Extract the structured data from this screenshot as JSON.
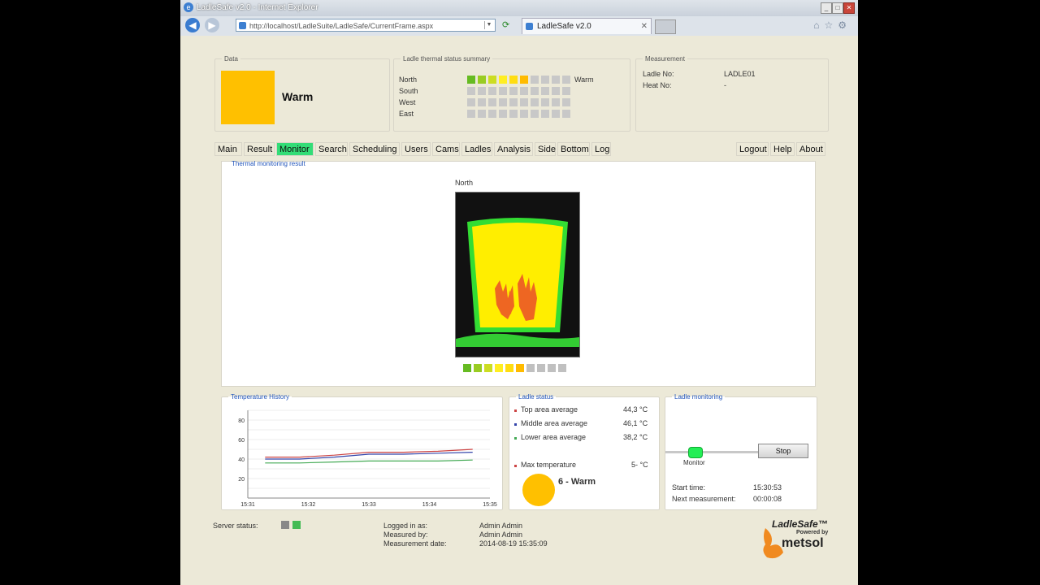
{
  "window": {
    "title": "LadleSafe v2.0 - Internet Explorer",
    "address": "http://localhost/LadleSuite/LadleSafe/CurrentFrame.aspx",
    "tab_label": "LadleSafe v2.0"
  },
  "data_box": {
    "legend": "Data",
    "status": "Warm",
    "color": "#ffc000"
  },
  "summary": {
    "legend": "Ladle thermal status summary",
    "rows": [
      {
        "name": "North",
        "label": "Warm",
        "cells": [
          "#66bb22",
          "#99cc22",
          "#ccdd22",
          "#ffee22",
          "#ffdd11",
          "#ffbb00",
          "#c8c8c8",
          "#c8c8c8",
          "#c8c8c8",
          "#c8c8c8"
        ]
      },
      {
        "name": "South",
        "label": "",
        "cells": [
          "#c8c8c8",
          "#c8c8c8",
          "#c8c8c8",
          "#c8c8c8",
          "#c8c8c8",
          "#c8c8c8",
          "#c8c8c8",
          "#c8c8c8",
          "#c8c8c8",
          "#c8c8c8"
        ]
      },
      {
        "name": "West",
        "label": "",
        "cells": [
          "#c8c8c8",
          "#c8c8c8",
          "#c8c8c8",
          "#c8c8c8",
          "#c8c8c8",
          "#c8c8c8",
          "#c8c8c8",
          "#c8c8c8",
          "#c8c8c8",
          "#c8c8c8"
        ]
      },
      {
        "name": "East",
        "label": "",
        "cells": [
          "#c8c8c8",
          "#c8c8c8",
          "#c8c8c8",
          "#c8c8c8",
          "#c8c8c8",
          "#c8c8c8",
          "#c8c8c8",
          "#c8c8c8",
          "#c8c8c8",
          "#c8c8c8"
        ]
      }
    ]
  },
  "measurement": {
    "legend": "Measurement",
    "ladle_label": "Ladle No:",
    "ladle_value": "LADLE01",
    "heat_label": "Heat No:",
    "heat_value": "-"
  },
  "menu_left": [
    "Main",
    "Result",
    "Monitor",
    "Search",
    "Scheduling",
    "Users",
    "Cams",
    "Ladles",
    "Analysis",
    "Side",
    "Bottom",
    "Log"
  ],
  "menu_active": "Monitor",
  "menu_right": [
    "Logout",
    "Help",
    "About"
  ],
  "monitor": {
    "legend": "Thermal monitoring result",
    "view": "North",
    "scale": [
      "#66bb22",
      "#99cc22",
      "#ccdd22",
      "#ffee22",
      "#ffdd11",
      "#ffbb00",
      "#c0c0c0",
      "#c0c0c0",
      "#c0c0c0",
      "#c0c0c0"
    ]
  },
  "chart_data": {
    "type": "line",
    "title": "Temperature History",
    "x": [
      "15:31",
      "15:32",
      "15:33",
      "15:34",
      "15:35"
    ],
    "ylim": [
      0,
      90
    ],
    "yticks": [
      20,
      40,
      60,
      80
    ],
    "series": [
      {
        "color": "#cc4444",
        "points": [
          [
            15.5,
            42
          ],
          [
            16.5,
            42
          ],
          [
            17.5,
            44
          ],
          [
            18.5,
            47
          ],
          [
            19.5,
            47
          ],
          [
            20.5,
            48
          ],
          [
            21.5,
            50
          ]
        ]
      },
      {
        "color": "#3344aa",
        "points": [
          [
            15.5,
            40
          ],
          [
            16.5,
            40
          ],
          [
            17.5,
            42
          ],
          [
            18.5,
            45
          ],
          [
            19.5,
            45
          ],
          [
            20.5,
            46
          ],
          [
            21.5,
            47
          ]
        ]
      },
      {
        "color": "#44aa55",
        "points": [
          [
            15.5,
            36
          ],
          [
            16.5,
            36
          ],
          [
            17.5,
            37
          ],
          [
            18.5,
            38
          ],
          [
            19.5,
            38
          ],
          [
            20.5,
            38
          ],
          [
            21.5,
            39
          ]
        ]
      }
    ]
  },
  "ladle_status": {
    "legend": "Ladle status",
    "rows": [
      {
        "label": "Top area average",
        "value": "44,3 °C",
        "color": "#cc4444"
      },
      {
        "label": "Middle area average",
        "value": "46,1 °C",
        "color": "#3344aa"
      },
      {
        "label": "Lower area average",
        "value": "38,2 °C",
        "color": "#44aa55"
      }
    ],
    "max_label": "Max temperature",
    "max_value": "5- °C",
    "max_color": "#cc4444",
    "level_text": "6 - Warm",
    "level_color": "#ffc000"
  },
  "ladle_monitoring": {
    "legend": "Ladle monitoring",
    "slider_label": "Monitor",
    "stop_label": "Stop",
    "start_label": "Start time:",
    "start_value": "15:30:53",
    "next_label": "Next measurement:",
    "next_value": "00:00:08"
  },
  "footer": {
    "server_label": "Server status:",
    "server_colors": [
      "#888888",
      "#44bb55"
    ],
    "logged_label": "Logged in as:",
    "logged_value": "Admin Admin",
    "measured_label": "Measured by:",
    "measured_value": "Admin Admin",
    "date_label": "Measurement date:",
    "date_value": "2014-08-19 15:35:09"
  },
  "logo": {
    "product": "LadleSafe™",
    "powered": "Powered by",
    "brand": "metsol"
  }
}
